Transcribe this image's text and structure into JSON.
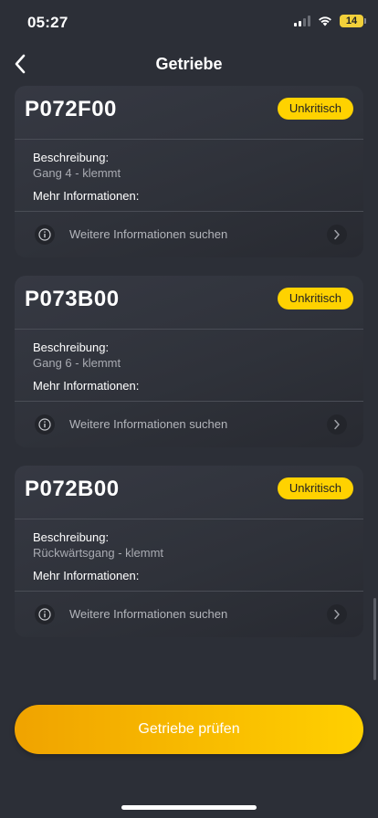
{
  "status_bar": {
    "time": "05:27",
    "battery": "14",
    "icons": [
      "signal-icon",
      "wifi-icon",
      "battery-icon"
    ]
  },
  "header": {
    "title": "Getriebe",
    "back_icon": "chevron-left-icon"
  },
  "cards": [
    {
      "code": "P072F00",
      "badge": "Unkritisch",
      "description_label": "Beschreibung:",
      "description": "Gang 4 - klemmt",
      "more_label": "Mehr Informationen:",
      "search_label": "Weitere Informationen suchen"
    },
    {
      "code": "P073B00",
      "badge": "Unkritisch",
      "description_label": "Beschreibung:",
      "description": "Gang 6 - klemmt",
      "more_label": "Mehr Informationen:",
      "search_label": "Weitere Informationen suchen"
    },
    {
      "code": "P072B00",
      "badge": "Unkritisch",
      "description_label": "Beschreibung:",
      "description": "Rückwärtsgang - klemmt",
      "more_label": "Mehr Informationen:",
      "search_label": "Weitere Informationen suchen"
    }
  ],
  "footer": {
    "cta_label": "Getriebe prüfen"
  },
  "colors": {
    "background": "#2c2f37",
    "badge": "#ffd200",
    "accent_start": "#f0a300",
    "accent_end": "#ffd000"
  }
}
